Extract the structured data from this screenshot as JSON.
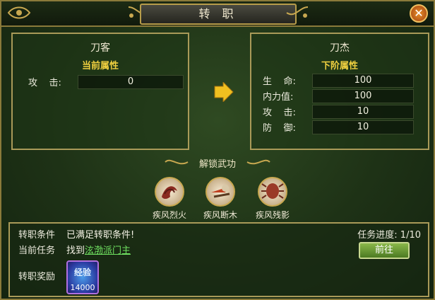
{
  "window": {
    "title": "转 职"
  },
  "current": {
    "class_name": "刀客",
    "section_title": "当前属性",
    "stats": [
      {
        "label": "攻    击:",
        "value": "0"
      }
    ]
  },
  "next": {
    "class_name": "刀杰",
    "section_title": "下阶属性",
    "stats": [
      {
        "label": "生    命:",
        "value": "100"
      },
      {
        "label": "内力值:",
        "value": "100"
      },
      {
        "label": "攻    击:",
        "value": "10"
      },
      {
        "label": "防    御:",
        "value": "10"
      }
    ]
  },
  "unlock": {
    "title": "解锁武功",
    "skills": [
      {
        "name": "疾风烈火",
        "icon": "swirl-fire-icon"
      },
      {
        "name": "疾风断木",
        "icon": "blade-slash-icon"
      },
      {
        "name": "疾风残影",
        "icon": "shadow-bug-icon"
      }
    ]
  },
  "requirements": {
    "condition_label": "转职条件",
    "condition_value": "已满足转职条件!",
    "task_label": "当前任务",
    "task_prefix": "找到",
    "task_link": "泫渤派门主",
    "progress_label": "任务进度:",
    "progress_value": "1/10",
    "goto_label": "前往",
    "reward_label": "转职奖励",
    "reward_item": {
      "text": "经验",
      "count": "14000"
    }
  },
  "colors": {
    "accent_gold": "#a99a58",
    "sub_title_yellow": "#f0d040",
    "link_green": "#6fe060"
  }
}
